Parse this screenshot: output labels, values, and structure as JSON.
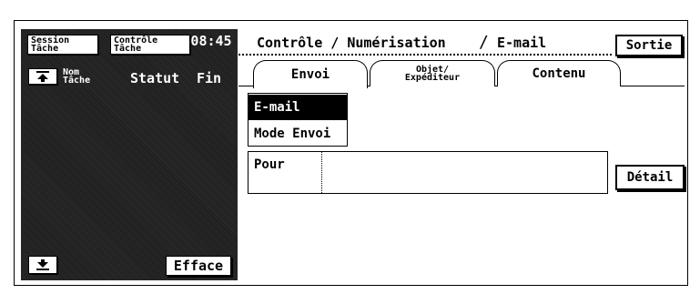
{
  "left_panel": {
    "session_btn": [
      "Session",
      "Tâche"
    ],
    "controle_btn": [
      "Contrôle",
      "Tâche"
    ],
    "clock": "08:45",
    "columns": {
      "nom": [
        "Nom",
        "Tâche"
      ],
      "statut": "Statut",
      "fin": "Fin"
    },
    "efface_label": "Efface"
  },
  "header": {
    "crumb_1": "Contrôle / Numérisation",
    "crumb_sep": "/",
    "crumb_2": "E-mail",
    "sortie_label": "Sortie"
  },
  "tabs": [
    {
      "label": "Envoi",
      "active": true
    },
    {
      "label_lines": [
        "Objet/",
        "Expéditeur"
      ],
      "active": false
    },
    {
      "label": "Contenu",
      "active": false
    }
  ],
  "modes": [
    {
      "label": "E-mail",
      "selected": true
    },
    {
      "label": "Mode Envoi",
      "selected": false
    }
  ],
  "recipient": {
    "label": "Pour",
    "value": "",
    "detail_label": "Détail"
  }
}
